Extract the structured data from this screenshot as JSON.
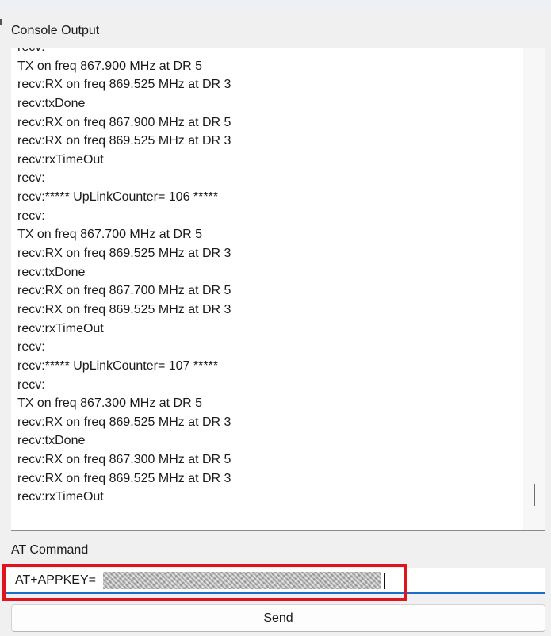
{
  "console": {
    "label": "Console Output",
    "lines": [
      "recv:",
      "TX on freq 867.900 MHz at DR 5",
      "recv:RX on freq 869.525 MHz at DR 3",
      "recv:txDone",
      "recv:RX on freq 867.900 MHz at DR 5",
      "recv:RX on freq 869.525 MHz at DR 3",
      "recv:rxTimeOut",
      "recv:",
      "recv:***** UpLinkCounter= 106 *****",
      "recv:",
      "TX on freq 867.700 MHz at DR 5",
      "recv:RX on freq 869.525 MHz at DR 3",
      "recv:txDone",
      "recv:RX on freq 867.700 MHz at DR 5",
      "recv:RX on freq 869.525 MHz at DR 3",
      "recv:rxTimeOut",
      "recv:",
      "recv:***** UpLinkCounter= 107 *****",
      "recv:",
      "TX on freq 867.300 MHz at DR 5",
      "recv:RX on freq 869.525 MHz at DR 3",
      "recv:txDone",
      "recv:RX on freq 867.300 MHz at DR 5",
      "recv:RX on freq 869.525 MHz at DR 3",
      "recv:rxTimeOut"
    ]
  },
  "at_command": {
    "label": "AT Command",
    "value": "AT+APPKEY="
  },
  "send": {
    "label": "Send"
  },
  "colors": {
    "highlight": "#e0141d",
    "input_underline": "#1a6dc9"
  }
}
